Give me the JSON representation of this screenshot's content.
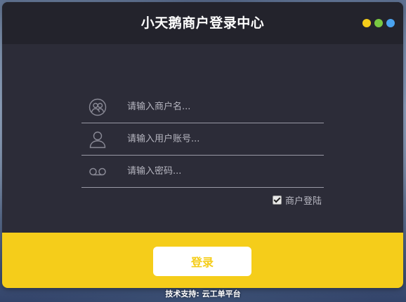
{
  "header": {
    "title": "小天鹅商户登录中心",
    "dots": [
      "#f5cd1a",
      "#79c842",
      "#4aa3f0"
    ]
  },
  "form": {
    "merchant_placeholder": "请输入商户名...",
    "account_placeholder": "请输入用户账号...",
    "password_placeholder": "请输入密码...",
    "merchant_icon": "merchant-users-icon",
    "account_icon": "user-icon",
    "password_icon": "voicemail-key-icon"
  },
  "remember": {
    "label": "商户登陆",
    "checked": true
  },
  "footer": {
    "login_label": "登录",
    "accent": "#f5cd1a"
  },
  "support_text": "技术支持: 云工单平台"
}
